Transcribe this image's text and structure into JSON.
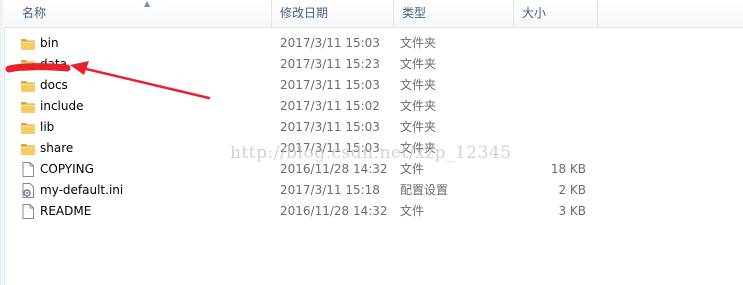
{
  "header": {
    "name": "名称",
    "date": "修改日期",
    "type": "类型",
    "size": "大小"
  },
  "files": [
    {
      "name": "bin",
      "date": "2017/3/11 15:03",
      "type": "文件夹",
      "size": "",
      "icon": "folder-icon"
    },
    {
      "name": "data",
      "date": "2017/3/11 15:23",
      "type": "文件夹",
      "size": "",
      "icon": "folder-icon"
    },
    {
      "name": "docs",
      "date": "2017/3/11 15:03",
      "type": "文件夹",
      "size": "",
      "icon": "folder-icon"
    },
    {
      "name": "include",
      "date": "2017/3/11 15:02",
      "type": "文件夹",
      "size": "",
      "icon": "folder-icon"
    },
    {
      "name": "lib",
      "date": "2017/3/11 15:03",
      "type": "文件夹",
      "size": "",
      "icon": "folder-icon"
    },
    {
      "name": "share",
      "date": "2017/3/11 15:03",
      "type": "文件夹",
      "size": "",
      "icon": "folder-icon"
    },
    {
      "name": "COPYING",
      "date": "2016/11/28 14:32",
      "type": "文件",
      "size": "18 KB",
      "icon": "file-icon"
    },
    {
      "name": "my-default.ini",
      "date": "2017/3/11 15:18",
      "type": "配置设置",
      "size": "2 KB",
      "icon": "settings-file-icon"
    },
    {
      "name": "README",
      "date": "2016/11/28 14:32",
      "type": "文件",
      "size": "3 KB",
      "icon": "file-icon"
    }
  ],
  "watermark": "http://blog.csdn.net/xzp_12345",
  "colors": {
    "annotation": "#e8212b",
    "folder": "#e8b84a",
    "header_text": "#4c607a"
  }
}
